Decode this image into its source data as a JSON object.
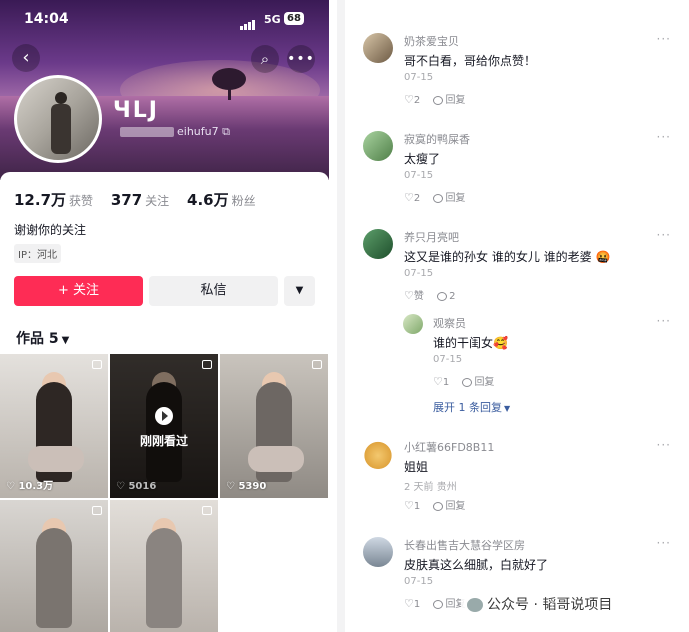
{
  "status_bar": {
    "time": "14:04",
    "network": "5G",
    "battery": "68"
  },
  "profile": {
    "nickname": "ЧLJ",
    "account_suffix": "eihufu7",
    "stats": [
      {
        "value": "12.7万",
        "label": "获赞"
      },
      {
        "value": "377",
        "label": "关注"
      },
      {
        "value": "4.6万",
        "label": "粉丝"
      }
    ],
    "bio": "谢谢你的关注",
    "ip_location": "IP：河北",
    "follow_label": "+ 关注",
    "message_label": "私信"
  },
  "works_tab": {
    "label": "作品 5"
  },
  "videos": [
    {
      "likes": "10.3万",
      "watched": ""
    },
    {
      "likes": "5016",
      "watched": "刚刚看过"
    },
    {
      "likes": "5390",
      "watched": ""
    },
    {
      "likes": "",
      "watched": ""
    },
    {
      "likes": "",
      "watched": ""
    }
  ],
  "comments": [
    {
      "name": "奶茶爱宝贝",
      "text": "哥不白看，哥给你点赞！",
      "date": "07-15",
      "likes": "2",
      "reply_label": "回复"
    },
    {
      "name": "寂寞的鸭屎香",
      "text": "太瘦了",
      "date": "07-15",
      "likes": "2",
      "reply_label": "回复"
    },
    {
      "name": "养只月亮吧",
      "text": "这又是谁的孙女 谁的女儿 谁的老婆 🤬",
      "date": "07-15",
      "likes": "赞",
      "reply_count": "2"
    },
    {
      "name": "观察员",
      "text": "谁的干闺女🥰",
      "date": "07-15",
      "likes": "1",
      "reply_label": "回复"
    },
    {
      "name": "小红薯66FD8B11",
      "text": "姐姐",
      "date": "2 天前 贵州",
      "likes": "1",
      "reply_label": "回复"
    },
    {
      "name": "长春出售吉大慧谷学区房",
      "text": "皮肤真这么细腻，白就好了",
      "date": "07-15",
      "likes": "1",
      "reply_label": "回复"
    }
  ],
  "expand_replies": "展开 1 条回复",
  "watermark": "公众号 · 韬哥说项目"
}
